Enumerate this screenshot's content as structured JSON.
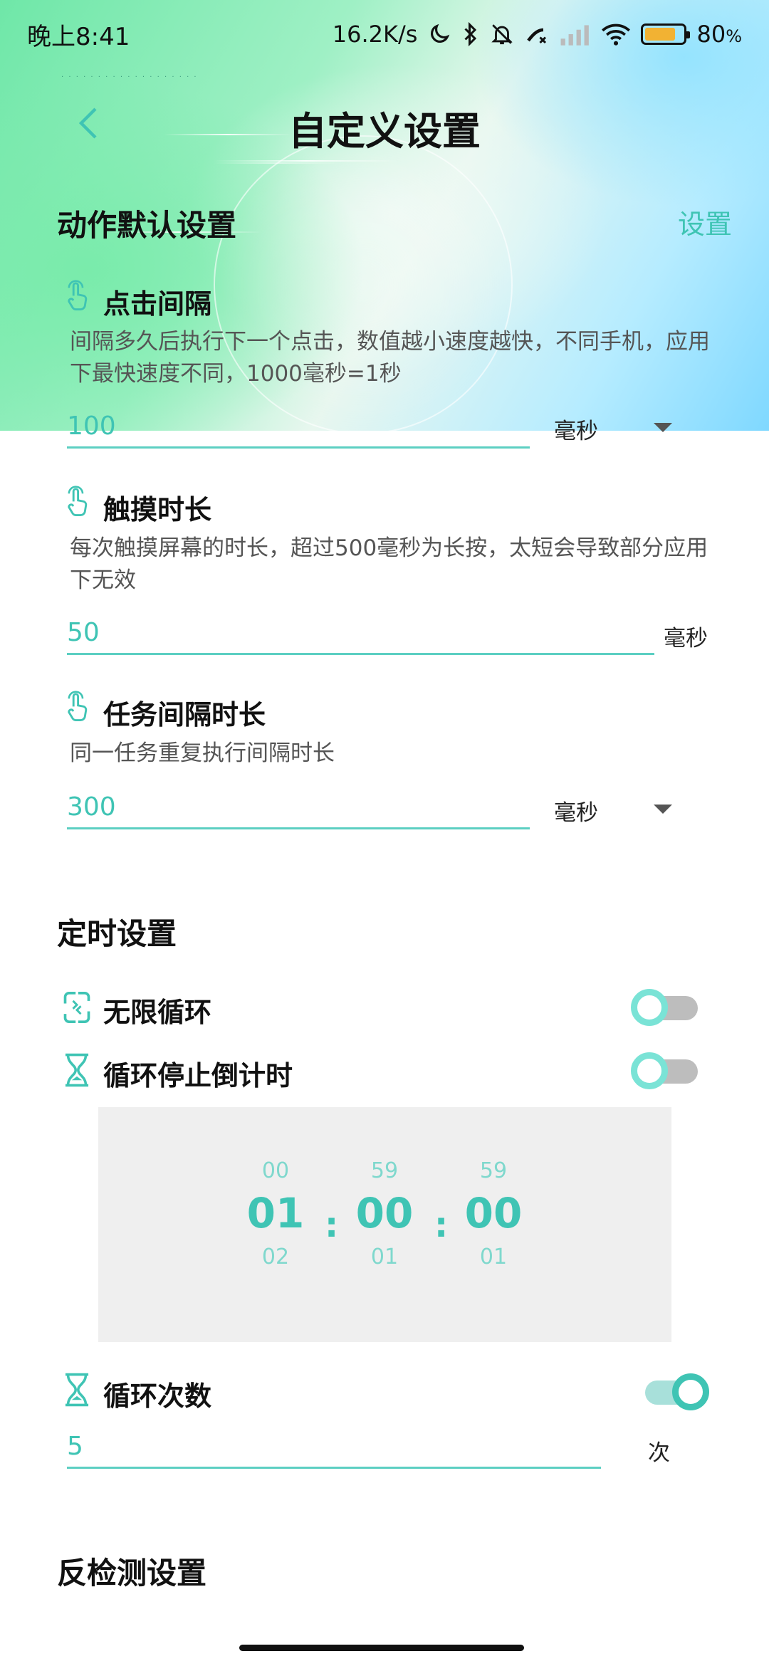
{
  "status_bar": {
    "time": "晚上8:41",
    "network_speed": "16.2K/s",
    "battery_percent": "80",
    "battery_unit": "%",
    "battery_level": 0.8,
    "icons": [
      "moon-icon",
      "bluetooth-icon",
      "bell-off-icon",
      "missed-call-icon",
      "signal-icon",
      "wifi-icon",
      "battery-icon"
    ]
  },
  "header": {
    "title": "自定义设置",
    "back_icon": "chevron-left-icon"
  },
  "action_section": {
    "title": "动作默认设置",
    "action_label": "设置",
    "items": [
      {
        "title": "点击间隔",
        "description": "间隔多久后执行下一个点击，数值越小速度越快，不同手机，应用下最快速度不同，1000毫秒=1秒",
        "value": "100",
        "unit": "毫秒",
        "has_dropdown": true
      },
      {
        "title": "触摸时长",
        "description": "每次触摸屏幕的时长，超过500毫秒为长按，太短会导致部分应用下无效",
        "value": "50",
        "unit": "毫秒",
        "has_dropdown": false
      },
      {
        "title": "任务间隔时长",
        "description": "同一任务重复执行间隔时长",
        "value": "300",
        "unit": "毫秒",
        "has_dropdown": true
      }
    ]
  },
  "timer_section": {
    "title": "定时设置",
    "infinite_loop": {
      "label": "无限循环",
      "enabled": false
    },
    "countdown": {
      "label": "循环停止倒计时",
      "enabled": false
    },
    "picker": {
      "hours": {
        "prev": "00",
        "current": "01",
        "next": "02"
      },
      "minutes": {
        "prev": "59",
        "current": "00",
        "next": "01"
      },
      "seconds": {
        "prev": "59",
        "current": "00",
        "next": "01"
      },
      "separator": ":"
    },
    "loop_count": {
      "label": "循环次数",
      "enabled": true,
      "value": "5",
      "unit": "次"
    }
  },
  "anti_detect_section": {
    "title": "反检测设置"
  },
  "colors": {
    "accent": "#3fc4b4",
    "accent_light": "#7ae3d6",
    "picker_bg": "#efefef"
  }
}
